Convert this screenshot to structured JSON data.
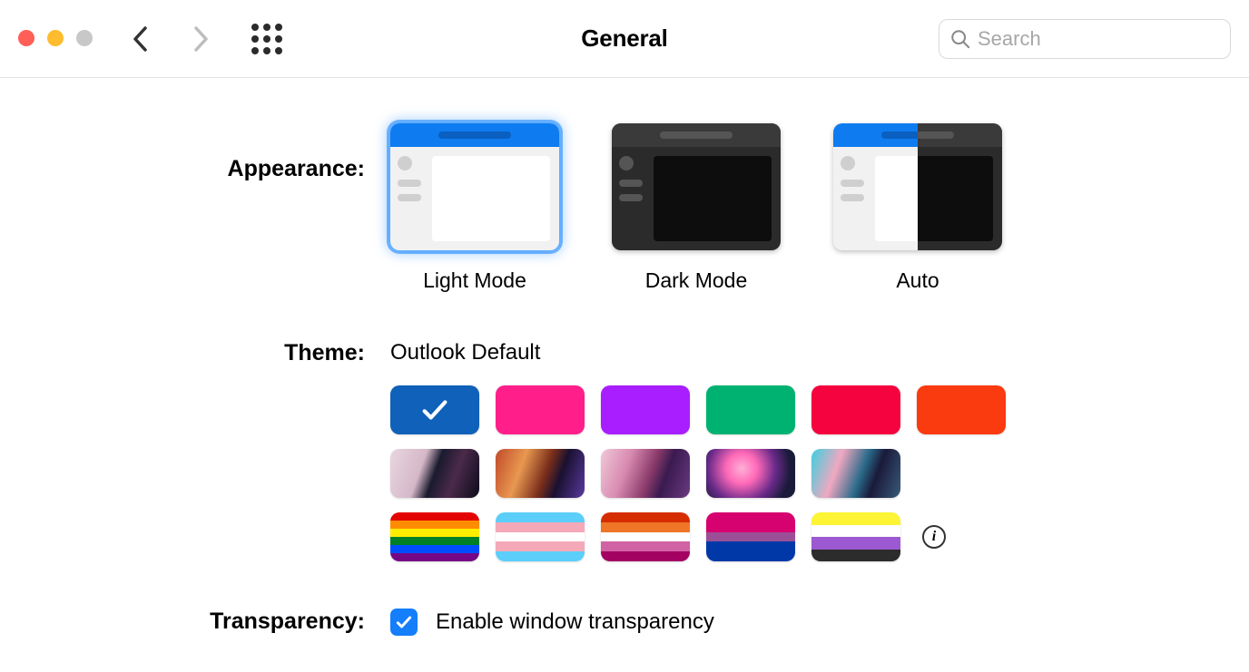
{
  "window": {
    "title": "General"
  },
  "search": {
    "placeholder": "Search"
  },
  "sections": {
    "appearance": {
      "label": "Appearance:",
      "options": [
        {
          "id": "light",
          "label": "Light Mode",
          "selected": true
        },
        {
          "id": "dark",
          "label": "Dark Mode",
          "selected": false
        },
        {
          "id": "auto",
          "label": "Auto",
          "selected": false
        }
      ]
    },
    "theme": {
      "label": "Theme:",
      "selected_name": "Outlook Default",
      "rows": [
        {
          "type": "solid",
          "swatches": [
            {
              "id": "outlook-default",
              "color": "#0F61B9",
              "selected": true
            },
            {
              "id": "magenta",
              "color": "#FF1E8A",
              "selected": false
            },
            {
              "id": "purple",
              "color": "#A81EFF",
              "selected": false
            },
            {
              "id": "green",
              "color": "#00B272",
              "selected": false
            },
            {
              "id": "red",
              "color": "#F5033E",
              "selected": false
            },
            {
              "id": "orange",
              "color": "#FA3A0F",
              "selected": false
            }
          ]
        },
        {
          "type": "image",
          "swatches": [
            {
              "id": "wallpaper-1"
            },
            {
              "id": "wallpaper-2"
            },
            {
              "id": "wallpaper-3"
            },
            {
              "id": "wallpaper-4"
            },
            {
              "id": "wallpaper-5"
            }
          ]
        },
        {
          "type": "flag",
          "swatches": [
            {
              "id": "pride-rainbow",
              "stripes": [
                "#E40303",
                "#FF8C00",
                "#FFED00",
                "#008026",
                "#004DFF",
                "#750787"
              ]
            },
            {
              "id": "pride-trans",
              "stripes": [
                "#5BCEFA",
                "#F5A9B8",
                "#FFFFFF",
                "#F5A9B8",
                "#5BCEFA"
              ]
            },
            {
              "id": "pride-lesbian",
              "stripes": [
                "#D52D00",
                "#EF7627",
                "#FFFFFF",
                "#D162A4",
                "#A30262"
              ]
            },
            {
              "id": "pride-bisexual",
              "stripes": [
                "#D60270",
                "#D60270",
                "#9B4F96",
                "#0038A8",
                "#0038A8"
              ]
            },
            {
              "id": "pride-nonbinary",
              "stripes": [
                "#FCF434",
                "#FFFFFF",
                "#9C59D1",
                "#2C2C2C"
              ]
            }
          ],
          "has_info": true
        }
      ]
    },
    "transparency": {
      "label": "Transparency:",
      "checkbox_label": "Enable window transparency",
      "checked": true
    }
  }
}
